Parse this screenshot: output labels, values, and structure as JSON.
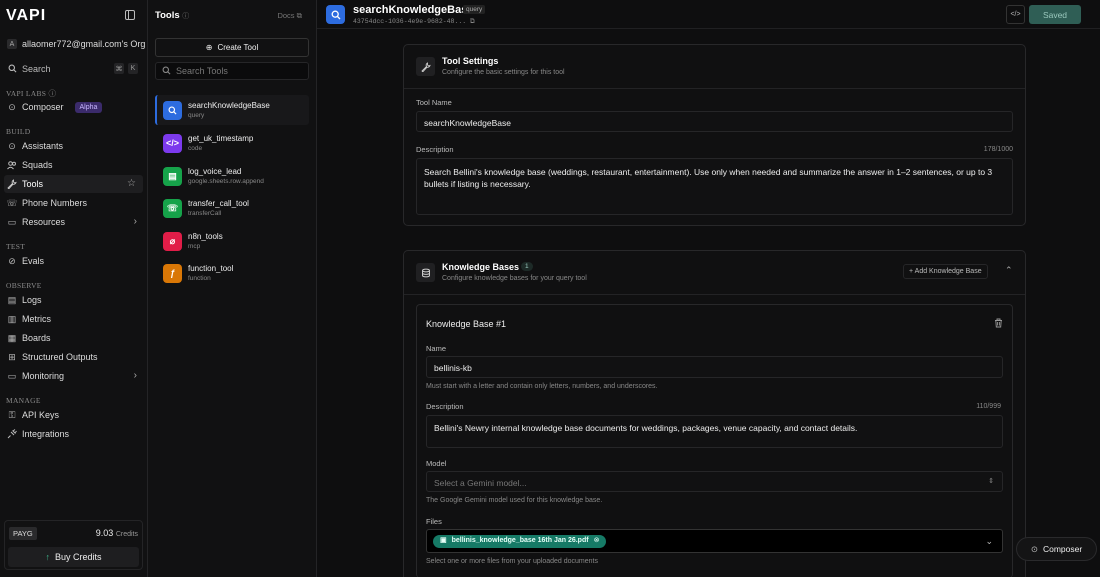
{
  "sidebar": {
    "logo": "VAPI",
    "org_avatar": "A",
    "org_name": "allaomer772@gmail.com's Org",
    "search_label": "Search",
    "search_kbd_1": "⌘",
    "search_kbd_2": "K",
    "vapi_labs_label": "VAPI LABS",
    "composer_label": "Composer",
    "alpha_badge": "Alpha",
    "build_label": "BUILD",
    "assistants": "Assistants",
    "squads": "Squads",
    "tools": "Tools",
    "phone_numbers": "Phone Numbers",
    "resources": "Resources",
    "test_label": "TEST",
    "evals": "Evals",
    "observe_label": "OBSERVE",
    "logs": "Logs",
    "metrics": "Metrics",
    "boards": "Boards",
    "structured_outputs": "Structured Outputs",
    "monitoring": "Monitoring",
    "manage_label": "MANAGE",
    "api_keys": "API Keys",
    "integrations": "Integrations",
    "payg": "PAYG",
    "credits_value": "9.03",
    "credits_unit": "Credits",
    "buy_credits": "Buy Credits"
  },
  "tools_panel": {
    "title": "Tools",
    "docs": "Docs",
    "create_tool": "Create Tool",
    "search_placeholder": "Search Tools",
    "items": [
      {
        "name": "searchKnowledgeBase",
        "type": "query",
        "color": "#2d6cdf"
      },
      {
        "name": "get_uk_timestamp",
        "type": "code",
        "color": "#7c3aed"
      },
      {
        "name": "log_voice_lead",
        "type": "google.sheets.row.append",
        "color": "#16a34a"
      },
      {
        "name": "transfer_call_tool",
        "type": "transferCall",
        "color": "#16a34a"
      },
      {
        "name": "n8n_tools",
        "type": "mcp",
        "color": "#e11d48"
      },
      {
        "name": "function_tool",
        "type": "function",
        "color": "#d97706"
      }
    ]
  },
  "header": {
    "title": "searchKnowledgeBase",
    "badge": "query",
    "id": "43754dcc-1036-4e9e-9682-48...",
    "saved": "Saved"
  },
  "tool_settings": {
    "title": "Tool Settings",
    "subtitle": "Configure the basic settings for this tool",
    "name_label": "Tool Name",
    "name_value": "searchKnowledgeBase",
    "description_label": "Description",
    "description_count": "178/1000",
    "description_value": "Search Bellini's knowledge base (weddings, restaurant, entertainment). Use only when needed and summarize the answer in 1–2 sentences, or up to 3 bullets if listing is necessary."
  },
  "knowledge_bases": {
    "title": "Knowledge Bases",
    "count": "1",
    "subtitle": "Configure knowledge bases for your query tool",
    "add_button": "Add Knowledge Base",
    "kb": {
      "title": "Knowledge Base #1",
      "name_label": "Name",
      "name_value": "bellinis-kb",
      "name_hint": "Must start with a letter and contain only letters, numbers, and underscores.",
      "description_label": "Description",
      "description_count": "110/999",
      "description_value": "Bellini's Newry internal knowledge base documents for weddings, packages, venue capacity, and contact details.",
      "model_label": "Model",
      "model_placeholder": "Select a Gemini model...",
      "model_hint": "The Google Gemini model used for this knowledge base.",
      "files_label": "Files",
      "file_name": "bellinis_knowledge_base 16th Jan 26.pdf",
      "files_hint": "Select one or more files from your uploaded documents"
    }
  },
  "composer_button": "Composer"
}
